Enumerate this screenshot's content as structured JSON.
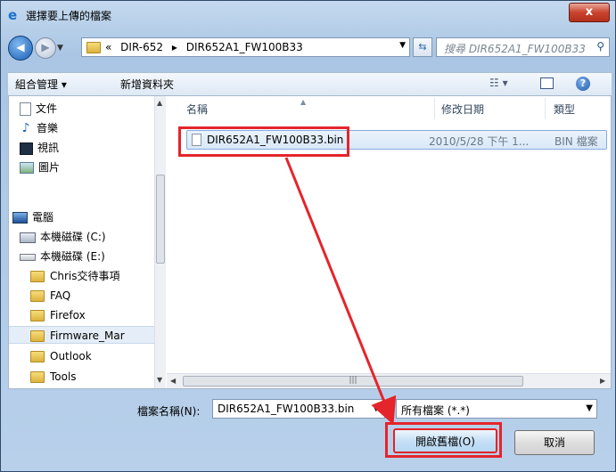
{
  "window": {
    "title": "選擇要上傳的檔案",
    "close_label": "x"
  },
  "address_bar": {
    "crumb_prefix": "«",
    "crumbs": [
      "DIR-652",
      "DIR652A1_FW100B33"
    ],
    "separator": "▸",
    "search_placeholder": "搜尋 DIR652A1_FW100B33"
  },
  "toolbar": {
    "organize_label": "組合管理 ▾",
    "new_folder_label": "新增資料夾",
    "view_label": "☷ ▾",
    "help_label": "?"
  },
  "nav": {
    "items": [
      {
        "label": "文件",
        "icon": "document-icon"
      },
      {
        "label": "音樂",
        "icon": "music-icon"
      },
      {
        "label": "視訊",
        "icon": "video-icon"
      },
      {
        "label": "圖片",
        "icon": "picture-icon"
      },
      {
        "label": "電腦",
        "icon": "computer-icon"
      },
      {
        "label": "本機磁碟 (C:)",
        "icon": "drive-icon"
      },
      {
        "label": "本機磁碟 (E:)",
        "icon": "drive-icon"
      },
      {
        "label": "Chris交待事項",
        "icon": "folder-icon"
      },
      {
        "label": "FAQ",
        "icon": "folder-icon"
      },
      {
        "label": "Firefox",
        "icon": "folder-icon"
      },
      {
        "label": "Firmware_Mar",
        "icon": "folder-icon"
      },
      {
        "label": "Outlook",
        "icon": "folder-icon"
      },
      {
        "label": "Tools",
        "icon": "folder-icon"
      }
    ]
  },
  "columns": {
    "name": "名稱",
    "date": "修改日期",
    "type": "類型"
  },
  "files": [
    {
      "name": "DIR652A1_FW100B33.bin",
      "date": "2010/5/28 下午 1...",
      "type": "BIN 檔案"
    }
  ],
  "footer": {
    "filename_label": "檔案名稱(N):",
    "filename_value": "DIR652A1_FW100B33.bin",
    "filetype_value": "所有檔案 (*.*)",
    "open_label": "開啟舊檔(O)",
    "cancel_label": "取消"
  },
  "colors": {
    "highlight": "#e4252b",
    "selection": "#d9e8f8"
  }
}
